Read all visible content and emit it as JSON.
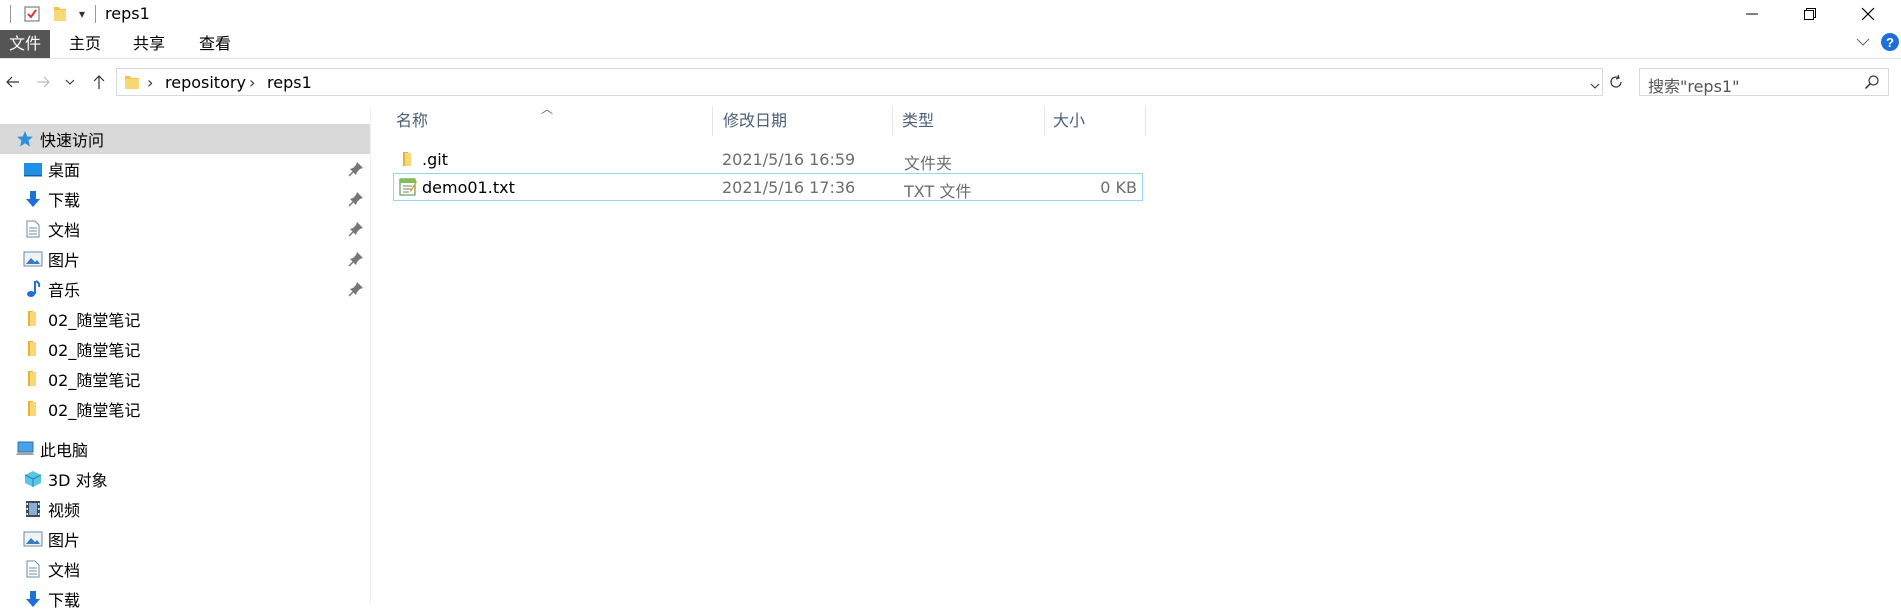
{
  "window": {
    "title": "reps1",
    "controls": [
      "minimize",
      "restore",
      "close"
    ]
  },
  "ribbon": {
    "tabs": [
      "文件",
      "主页",
      "共享",
      "查看"
    ]
  },
  "address": {
    "breadcrumb": [
      "repository",
      "reps1"
    ]
  },
  "search": {
    "placeholder": "搜索\"reps1\""
  },
  "sidebar": {
    "quick_access": {
      "label": "快速访问",
      "items": [
        {
          "label": "桌面",
          "icon": "desktop-icon",
          "pinned": true
        },
        {
          "label": "下载",
          "icon": "download-icon",
          "pinned": true
        },
        {
          "label": "文档",
          "icon": "document-icon",
          "pinned": true
        },
        {
          "label": "图片",
          "icon": "picture-icon",
          "pinned": true
        },
        {
          "label": "音乐",
          "icon": "music-icon",
          "pinned": true
        },
        {
          "label": "02_随堂笔记",
          "icon": "folder-icon",
          "pinned": false
        },
        {
          "label": "02_随堂笔记",
          "icon": "folder-icon",
          "pinned": false
        },
        {
          "label": "02_随堂笔记",
          "icon": "folder-icon",
          "pinned": false
        },
        {
          "label": "02_随堂笔记",
          "icon": "folder-icon",
          "pinned": false
        }
      ]
    },
    "this_pc": {
      "label": "此电脑",
      "items": [
        {
          "label": "3D 对象",
          "icon": "3d-objects-icon"
        },
        {
          "label": "视频",
          "icon": "video-icon"
        },
        {
          "label": "图片",
          "icon": "picture-icon"
        },
        {
          "label": "文档",
          "icon": "document-icon"
        },
        {
          "label": "下载",
          "icon": "download-icon"
        }
      ]
    }
  },
  "filelist": {
    "columns": [
      "名称",
      "修改日期",
      "类型",
      "大小"
    ],
    "rows": [
      {
        "name": ".git",
        "modified": "2021/5/16 16:59",
        "type": "文件夹",
        "size": "",
        "icon": "folder-icon",
        "selected": false
      },
      {
        "name": "demo01.txt",
        "modified": "2021/5/16 17:36",
        "type": "TXT 文件",
        "size": "0 KB",
        "icon": "text-file-icon",
        "selected": true
      }
    ]
  },
  "colors": {
    "file_tab_bg": "#555555",
    "selection_border": "#99d1ff",
    "header_text": "#4c607a",
    "folder_yellow": "#f3c24b",
    "help_blue": "#1e6fd9"
  }
}
